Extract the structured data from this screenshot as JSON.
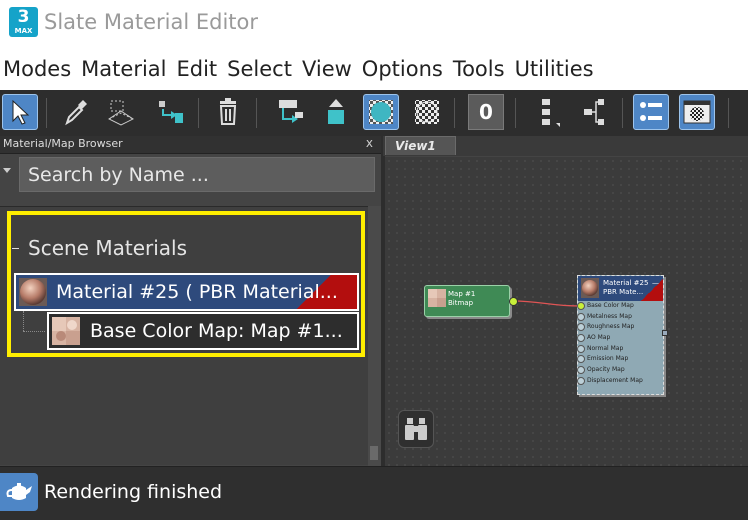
{
  "app": {
    "logo_number": "3",
    "logo_sub": "MAX",
    "title": "Slate Material Editor"
  },
  "menu": [
    "Modes",
    "Material",
    "Edit",
    "Select",
    "View",
    "Options",
    "Tools",
    "Utilities"
  ],
  "toolbar": {
    "buttons": [
      {
        "name": "select-tool",
        "icon": "arrow-cursor-icon",
        "active": true
      },
      {
        "name": "pick-material",
        "icon": "eyedropper-icon",
        "active": false
      },
      {
        "name": "put-to-scene",
        "icon": "put-material-icon",
        "active": false
      },
      {
        "name": "assign-to-selection",
        "icon": "assign-material-icon",
        "active": false
      },
      {
        "name": "delete",
        "icon": "trash-icon",
        "active": false
      },
      {
        "name": "move-children",
        "icon": "move-children-icon",
        "active": false
      },
      {
        "name": "go-to-parent",
        "icon": "node-shape-icon",
        "active": false
      },
      {
        "name": "show-background",
        "icon": "checker-sphere-icon",
        "active": true
      },
      {
        "name": "background-in-preview",
        "icon": "checker-icon",
        "active": false
      },
      {
        "name": "material-id",
        "icon": "zero-icon",
        "label": "0",
        "active": false
      },
      {
        "name": "layout-all",
        "icon": "layout-vertical-icon",
        "active": false
      },
      {
        "name": "layout-children",
        "icon": "layout-tree-icon",
        "active": false
      },
      {
        "name": "material-map-browser",
        "icon": "list-icon",
        "active": true
      },
      {
        "name": "parameter-editor",
        "icon": "parameter-window-icon",
        "active": true
      }
    ],
    "colors": {
      "active": "#4e86c6",
      "bg": "#2d2d2d"
    }
  },
  "browser": {
    "title": "Material/Map Browser",
    "close": "x",
    "search_placeholder": "Search by Name ...",
    "group_label": "Scene Materials",
    "items": [
      {
        "label": "Material #25  ( PBR Material...",
        "type": "material"
      },
      {
        "label": "Base Color Map: Map #1...",
        "type": "map"
      }
    ],
    "highlight_color": "#ffee00"
  },
  "view": {
    "tab": "View1",
    "map_node": {
      "title": "Map #1",
      "subtitle": "Bitmap"
    },
    "material_node": {
      "title": "Material #25",
      "subtitle": "PBR Mate...",
      "collapse": "—",
      "slots": [
        "Base Color Map",
        "Metalness Map",
        "Roughness Map",
        "AO Map",
        "Normal Map",
        "Emission Map",
        "Opacity Map",
        "Displacement Map"
      ]
    }
  },
  "status": {
    "text": "Rendering finished",
    "icon": "teapot-icon"
  }
}
